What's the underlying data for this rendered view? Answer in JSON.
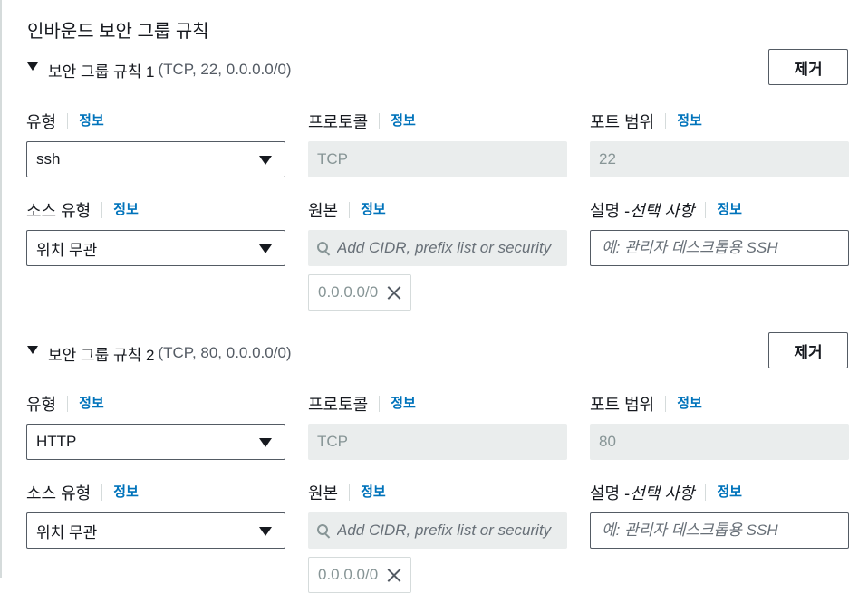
{
  "section": {
    "title": "인바운드 보안 그룹 규칙"
  },
  "rules": [
    {
      "title": "보안 그룹 규칙 1",
      "meta": "(TCP, 22, 0.0.0.0/0)",
      "remove_label": "제거",
      "type_label": "유형",
      "type_value": "ssh",
      "protocol_label": "프로토콜",
      "protocol_value": "TCP",
      "port_label": "포트 범위",
      "port_value": "22",
      "source_type_label": "소스 유형",
      "source_type_value": "위치 무관",
      "source_label": "원본",
      "source_placeholder": "Add CIDR, prefix list or security",
      "source_token": "0.0.0.0/0",
      "desc_label": "설명 - ",
      "desc_label_optional": "선택 사항",
      "desc_placeholder": "예: 관리자 데스크톱용 SSH",
      "info": "정보"
    },
    {
      "title": "보안 그룹 규칙 2",
      "meta": "(TCP, 80, 0.0.0.0/0)",
      "remove_label": "제거",
      "type_label": "유형",
      "type_value": "HTTP",
      "protocol_label": "프로토콜",
      "protocol_value": "TCP",
      "port_label": "포트 범위",
      "port_value": "80",
      "source_type_label": "소스 유형",
      "source_type_value": "위치 무관",
      "source_label": "원본",
      "source_placeholder": "Add CIDR, prefix list or security",
      "source_token": "0.0.0.0/0",
      "desc_label": "설명 - ",
      "desc_label_optional": "선택 사항",
      "desc_placeholder": "예: 관리자 데스크톱용 SSH",
      "info": "정보"
    }
  ],
  "colors": {
    "link": "#0073bb",
    "readonly_bg": "#eaeded",
    "border": "#545b64"
  }
}
